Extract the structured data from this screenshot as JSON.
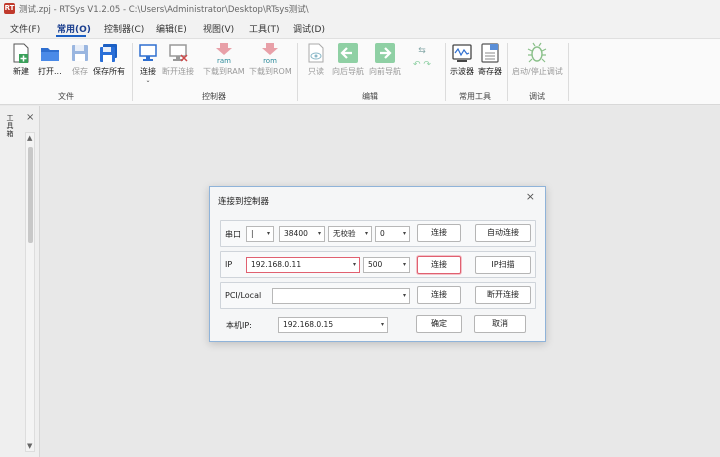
{
  "window": {
    "title": "测试.zpj - RTSys V1.2.05 - C:\\Users\\Administrator\\Desktop\\RTsys测试\\",
    "logo_text": "RT"
  },
  "menu": {
    "items": [
      "文件(F)",
      "常用(O)",
      "控制器(C)",
      "编辑(E)",
      "视图(V)",
      "工具(T)",
      "调试(D)"
    ],
    "active": "常用(O)"
  },
  "ribbon": {
    "groups": {
      "file": "文件",
      "controller": "控制器",
      "edit": "编辑",
      "tools": "常用工具",
      "debug": "调试"
    },
    "buttons": {
      "new": "新建",
      "open": "打开...",
      "save": "保存",
      "save_all": "保存所有",
      "connect": "连接",
      "disconnect": "断开连接",
      "download_ram": "下载到RAM",
      "download_rom": "下载到ROM",
      "readonly": "只读",
      "nav_back": "向后导航",
      "nav_forward": "向前导航",
      "oscilloscope": "示波器",
      "register": "寄存器",
      "start_stop_debug": "启动/停止调试",
      "ram_icon_text": "ram",
      "rom_icon_text": "rom"
    }
  },
  "side_panel": {
    "tab_label": "工具箱",
    "close": "×"
  },
  "dialog": {
    "title": "连接到控制器",
    "close": "×",
    "serial": {
      "label": "串口",
      "port_value": "",
      "baud_value": "38400",
      "parity_value": "无校验",
      "extra_value": "0",
      "connect": "连接",
      "auto_connect": "自动连接"
    },
    "ip": {
      "label": "IP",
      "address_value": "192.168.0.11",
      "port_value": "500",
      "connect": "连接",
      "scan": "IP扫描"
    },
    "pci": {
      "label": "PCI/Local",
      "value": "",
      "connect": "连接",
      "disconnect": "断开连接"
    },
    "local_ip": {
      "label": "本机IP:",
      "value": "192.168.0.15",
      "ok": "确定",
      "cancel": "取消"
    }
  },
  "colors": {
    "accent": "#1b5fc4",
    "focus_red": "#e06070",
    "green_arrow": "#4caf6a",
    "logo_red": "#c0392b"
  }
}
